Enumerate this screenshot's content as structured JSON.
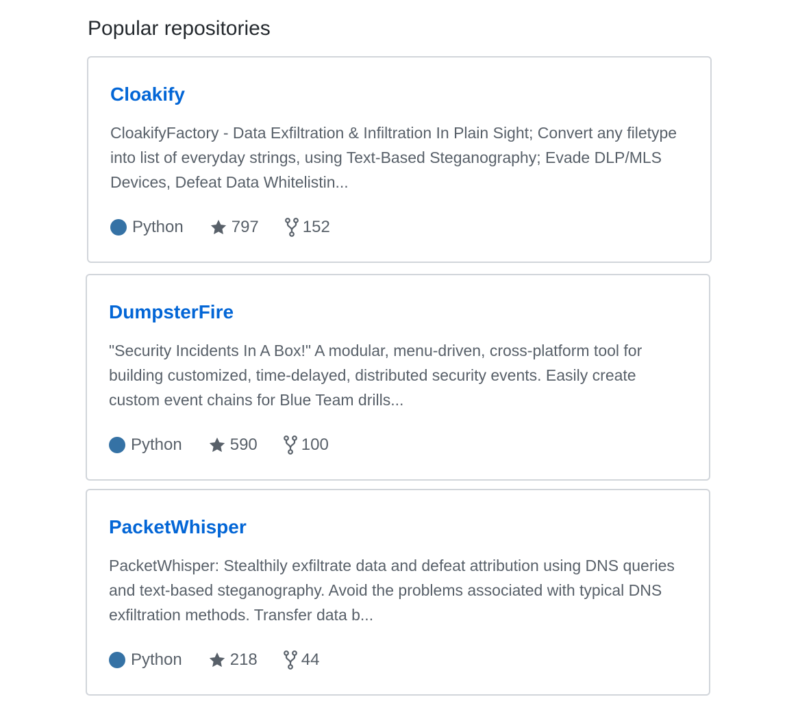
{
  "section": {
    "title": "Popular repositories"
  },
  "repos": [
    {
      "name": "Cloakify",
      "description": "CloakifyFactory - Data Exfiltration & Infiltration In Plain Sight; Convert any filetype into list of everyday strings, using Text-Based Steganography; Evade DLP/MLS Devices, Defeat Data Whitelistin...",
      "language": "Python",
      "language_color": "#3572A5",
      "stars": "797",
      "forks": "152"
    },
    {
      "name": "DumpsterFire",
      "description": "\"Security Incidents In A Box!\" A modular, menu-driven, cross-platform tool for building customized, time-delayed, distributed security events. Easily create custom event chains for Blue Team drills...",
      "language": "Python",
      "language_color": "#3572A5",
      "stars": "590",
      "forks": "100"
    },
    {
      "name": "PacketWhisper",
      "description": "PacketWhisper: Stealthily exfiltrate data and defeat attribution using DNS queries and text-based steganography. Avoid the problems associated with typical DNS exfiltration methods. Transfer data b...",
      "language": "Python",
      "language_color": "#3572A5",
      "stars": "218",
      "forks": "44"
    }
  ],
  "icons": {
    "star": "star-icon",
    "fork": "repo-forked-icon"
  },
  "colors": {
    "link": "#0366d6",
    "muted_text": "#586069",
    "border": "#d1d5da"
  }
}
